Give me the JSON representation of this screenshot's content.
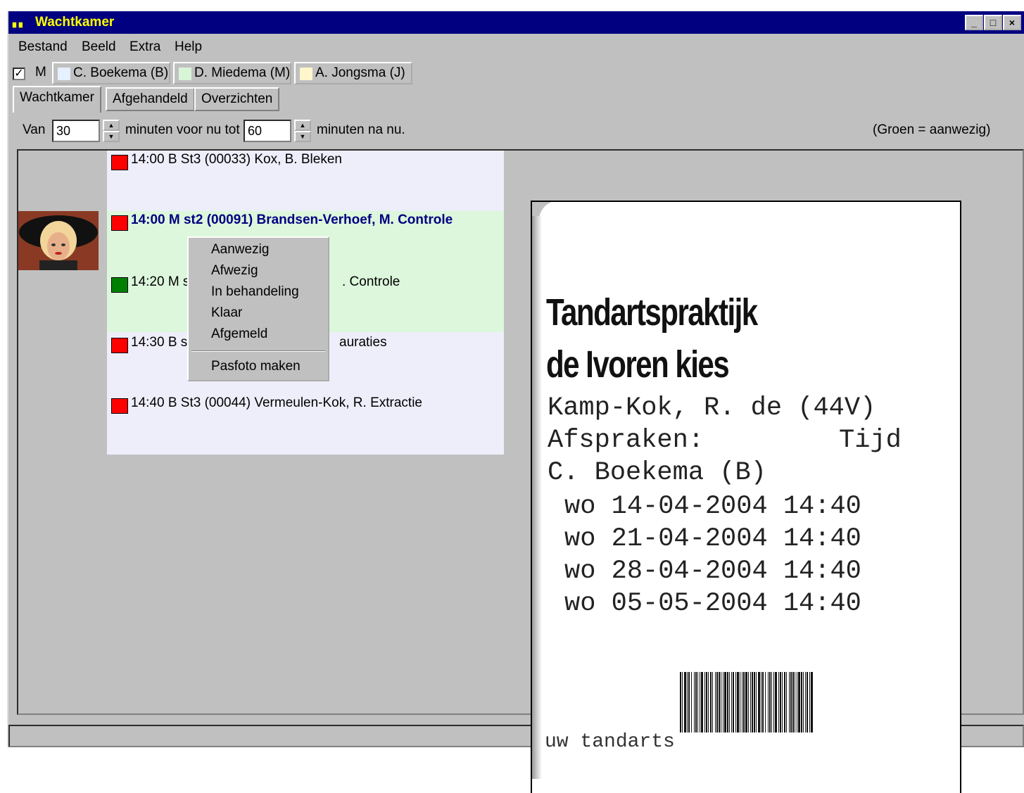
{
  "window": {
    "title": "Wachtkamer",
    "controls": {
      "minimize": "_",
      "maximize": "□",
      "close": "×"
    }
  },
  "menu": [
    "Bestand",
    "Beeld",
    "Extra",
    "Help"
  ],
  "practitioner_bar": {
    "checkbox_label": "M",
    "checked": true,
    "practitioners": [
      {
        "label": "C. Boekema (B)",
        "color": "#e6f0ff"
      },
      {
        "label": "D. Miedema (M)",
        "color": "#d8f5d8"
      },
      {
        "label": "A. Jongsma (J)",
        "color": "#fff6cc"
      }
    ]
  },
  "tabs": [
    "Wachtkamer",
    "Afgehandeld",
    "Overzichten"
  ],
  "filter": {
    "van_label": "Van",
    "from_value": "30",
    "middle_text": "minuten voor nu tot",
    "to_value": "60",
    "end_text": "minuten na nu.",
    "legend": "(Groen = aanwezig)"
  },
  "appointments": [
    {
      "text": "14:00 B St3 (00033) Kox, B.  Bleken",
      "status": "afwezig",
      "color": "#ff0000",
      "current": false
    },
    {
      "text": "14:00 M st2 (00091) Brandsen-Verhoef, M.  Controle",
      "status": "afwezig",
      "color": "#ff0000",
      "current": true
    },
    {
      "text": "14:20 M st2",
      "tail": ". Controle",
      "status": "aanwezig",
      "color": "#008000",
      "current": false
    },
    {
      "text": "14:30 B st1",
      "tail": "auraties",
      "status": "afwezig",
      "color": "#ff0000",
      "current": false
    },
    {
      "text": "14:40 B St3 (00044) Vermeulen-Kok, R.  Extractie",
      "status": "afwezig",
      "color": "#ff0000",
      "current": false
    }
  ],
  "context_menu": {
    "items": [
      "Aanwezig",
      "Afwezig",
      "In behandeling",
      "Klaar",
      "Afgemeld"
    ],
    "extra": "Pasfoto maken"
  },
  "card": {
    "heading_line1": "Tandartspraktijk",
    "heading_line2": "de Ivoren kies",
    "patient": "Kamp-Kok, R. de (44V)",
    "afspraken_label": "Afspraken:",
    "tijd_label": "Tijd",
    "practitioner": "C. Boekema (B)",
    "appointments": [
      "wo 14-04-2004 14:40",
      "wo 21-04-2004 14:40",
      "wo 28-04-2004 14:40",
      "wo 05-05-2004 14:40"
    ],
    "footer": "uw tandarts"
  }
}
